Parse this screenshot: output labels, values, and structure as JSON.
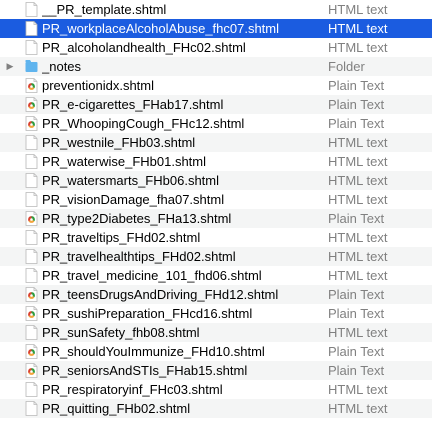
{
  "files": [
    {
      "name": "__PR_template.shtml",
      "kind": "HTML text",
      "icon": "html-file-icon"
    },
    {
      "name": "PR_workplaceAlcoholAbuse_fhc07.shtml",
      "kind": "HTML text",
      "icon": "html-file-icon",
      "selected": true
    },
    {
      "name": "PR_alcoholandhealth_FHc02.shtml",
      "kind": "HTML text",
      "icon": "html-file-icon"
    },
    {
      "name": "_notes",
      "kind": "Folder",
      "icon": "folder-icon",
      "folder": true
    },
    {
      "name": "preventionidx.shtml",
      "kind": "Plain Text",
      "icon": "plain-text-file-icon"
    },
    {
      "name": "PR_e-cigarettes_FHab17.shtml",
      "kind": "Plain Text",
      "icon": "plain-text-file-icon"
    },
    {
      "name": "PR_WhoopingCough_FHc12.shtml",
      "kind": "Plain Text",
      "icon": "plain-text-file-icon"
    },
    {
      "name": "PR_westnile_FHb03.shtml",
      "kind": "HTML text",
      "icon": "html-file-icon"
    },
    {
      "name": "PR_waterwise_FHb01.shtml",
      "kind": "HTML text",
      "icon": "html-file-icon"
    },
    {
      "name": "PR_watersmarts_FHb06.shtml",
      "kind": "HTML text",
      "icon": "html-file-icon"
    },
    {
      "name": "PR_visionDamage_fha07.shtml",
      "kind": "HTML text",
      "icon": "html-file-icon"
    },
    {
      "name": "PR_type2Diabetes_FHa13.shtml",
      "kind": "Plain Text",
      "icon": "plain-text-file-icon"
    },
    {
      "name": "PR_traveltips_FHd02.shtml",
      "kind": "HTML text",
      "icon": "html-file-icon"
    },
    {
      "name": "PR_travelhealthtips_FHd02.shtml",
      "kind": "HTML text",
      "icon": "html-file-icon"
    },
    {
      "name": "PR_travel_medicine_101_fhd06.shtml",
      "kind": "HTML text",
      "icon": "html-file-icon"
    },
    {
      "name": "PR_teensDrugsAndDriving_FHd12.shtml",
      "kind": "Plain Text",
      "icon": "plain-text-file-icon"
    },
    {
      "name": "PR_sushiPreparation_FHcd16.shtml",
      "kind": "Plain Text",
      "icon": "plain-text-file-icon"
    },
    {
      "name": "PR_sunSafety_fhb08.shtml",
      "kind": "HTML text",
      "icon": "html-file-icon"
    },
    {
      "name": "PR_shouldYouImmunize_FHd10.shtml",
      "kind": "Plain Text",
      "icon": "plain-text-file-icon"
    },
    {
      "name": "PR_seniorsAndSTIs_FHab15.shtml",
      "kind": "Plain Text",
      "icon": "plain-text-file-icon"
    },
    {
      "name": "PR_respiratoryinf_FHc03.shtml",
      "kind": "HTML text",
      "icon": "html-file-icon"
    },
    {
      "name": "PR_quitting_FHb02.shtml",
      "kind": "HTML text",
      "icon": "html-file-icon"
    }
  ],
  "colors": {
    "selection": "#1b5ce0",
    "folder": "#5fb4ee",
    "plain_text_badge_green": "#2e9d3f",
    "plain_text_badge_red": "#d9412f",
    "plain_text_badge_orange": "#f2a33a"
  }
}
